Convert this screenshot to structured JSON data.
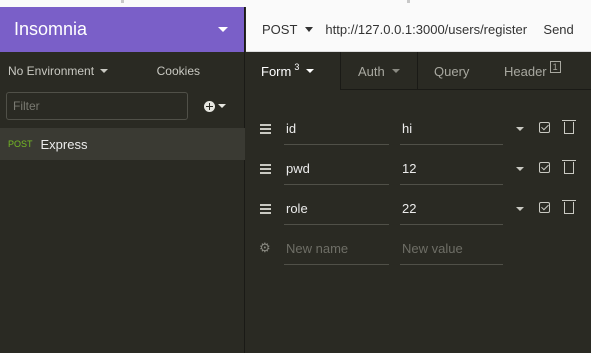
{
  "app": {
    "name": "Insomnia"
  },
  "sidebar": {
    "environment": "No Environment",
    "cookies_label": "Cookies",
    "filter_placeholder": "Filter",
    "requests": [
      {
        "method": "POST",
        "name": "Express"
      }
    ]
  },
  "request": {
    "method": "POST",
    "url": "http://127.0.0.1:3000/users/register",
    "send_label": "Send"
  },
  "tabs": [
    {
      "label": "Form",
      "badge": "3",
      "active": true
    },
    {
      "label": "Auth"
    },
    {
      "label": "Query"
    },
    {
      "label": "Header",
      "badge": "1"
    }
  ],
  "params": [
    {
      "name": "id",
      "value": "hi"
    },
    {
      "name": "pwd",
      "value": "12"
    },
    {
      "name": "role",
      "value": "22"
    }
  ],
  "new_param": {
    "name_placeholder": "New name",
    "value_placeholder": "New value"
  },
  "colors": {
    "brand": "#7a5fc8",
    "method_post": "#75ba24",
    "background": "#2a2a23"
  }
}
